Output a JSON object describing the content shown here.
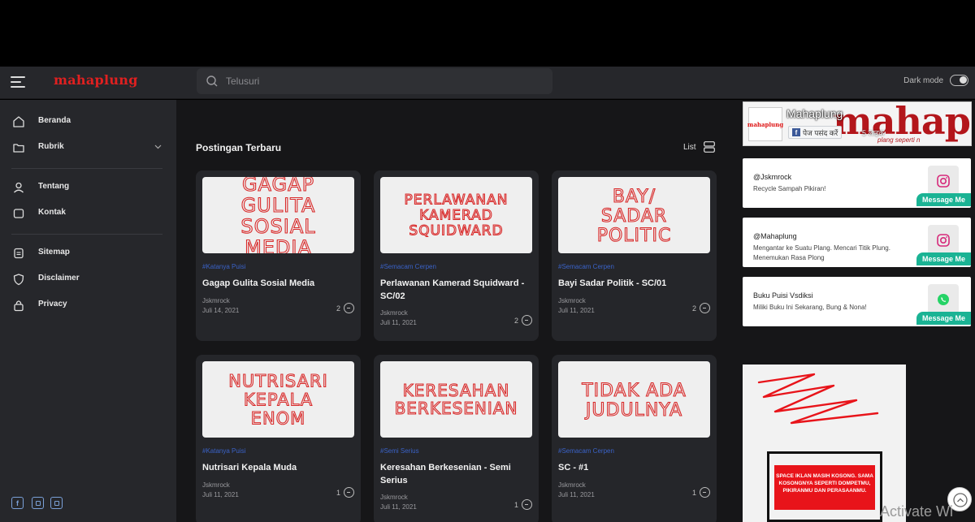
{
  "header": {
    "logo": "mahaplung",
    "search_placeholder": "Telusuri",
    "dark_mode_label": "Dark mode"
  },
  "sidebar": {
    "items": [
      {
        "label": "Beranda",
        "icon": "home-icon"
      },
      {
        "label": "Rubrik",
        "icon": "folder-icon"
      },
      {
        "label": "Tentang",
        "icon": "user-icon"
      },
      {
        "label": "Kontak",
        "icon": "contact-icon"
      },
      {
        "label": "Sitemap",
        "icon": "sitemap-icon"
      },
      {
        "label": "Disclaimer",
        "icon": "shield-icon"
      },
      {
        "label": "Privacy",
        "icon": "lock-icon"
      }
    ],
    "social": [
      "facebook-icon",
      "square-icon",
      "square-icon"
    ]
  },
  "main": {
    "title": "Postingan Terbaru",
    "view_label": "List",
    "posts": [
      {
        "category": "#Katanya Puisi",
        "title": "Gagap Gulita Sosial Media",
        "author": "Jskmrock",
        "date": "Juli 14, 2021",
        "comments": "2",
        "thumb": [
          "GAGAP",
          "GULITA",
          "SOSIAL",
          "MEDIA"
        ]
      },
      {
        "category": "#Semacam Cerpen",
        "title": "Perlawanan Kamerad Squidward - SC/02",
        "author": "Jskmrock",
        "date": "Juli 11, 2021",
        "comments": "2",
        "thumb": [
          "PERLAWANAN",
          "KAMERAD",
          "SQUIDWARD"
        ]
      },
      {
        "category": "#Semacam Cerpen",
        "title": "Bayi Sadar Politik - SC/01",
        "author": "Jskmrock",
        "date": "Juli 11, 2021",
        "comments": "2",
        "thumb": [
          "BAY/",
          "SADAR",
          "POLITIC"
        ]
      },
      {
        "category": "#Katanya Puisi",
        "title": "Nutrisari Kepala Muda",
        "author": "Jskmrock",
        "date": "Juli 11, 2021",
        "comments": "1",
        "thumb": [
          "NUTRISARI",
          "KEPALA",
          "ENOM"
        ]
      },
      {
        "category": "#Semi Serius",
        "title": "Keresahan Berkesenian - Semi Serius",
        "author": "Jskmrock",
        "date": "Juli 11, 2021",
        "comments": "1",
        "thumb": [
          "KERESAHAN",
          "BERKESENIAN"
        ]
      },
      {
        "category": "#Semacam Cerpen",
        "title": "SC - #1",
        "author": "Jskmrock",
        "date": "Juli 11, 2021",
        "comments": "1",
        "thumb": [
          "TIDAK ADA",
          "JUDULNYA"
        ]
      }
    ]
  },
  "right": {
    "fb": {
      "name": "Mahaplung",
      "like_label": "पेज पसंद करें",
      "count": "5 लाइक",
      "banner": "mahaplung",
      "banner_sub": "plang seperti n",
      "logo_text": "mahaplung"
    },
    "messages": [
      {
        "title": "@Jskmrock",
        "desc": "Recycle Sampah Pikiran!",
        "button": "Message Me",
        "icon": "instagram-icon"
      },
      {
        "title": "@Mahaplung",
        "desc": "Mengantar ke Suatu Plang. Mencari Titik Plung. Menemukan Rasa Plong",
        "button": "Message Me",
        "icon": "instagram-icon"
      },
      {
        "title": "Buku Puisi Vsdiksi",
        "desc": "Miliki Buku Ini Sekarang, Bung & Nona!",
        "button": "Message Me",
        "icon": "whatsapp-icon"
      }
    ],
    "ad_text": "SPACE IKLAN MASIH KOSONG. SAMA KOSONGNYA SEPERTI DOMPETMU, PIKIRANMU DAN PERASAANMU."
  },
  "overlay": {
    "activate": "Activate Wi"
  },
  "colors": {
    "accent_red": "#e02020",
    "category_blue": "#3a62c7",
    "message_green": "#1ab394"
  }
}
